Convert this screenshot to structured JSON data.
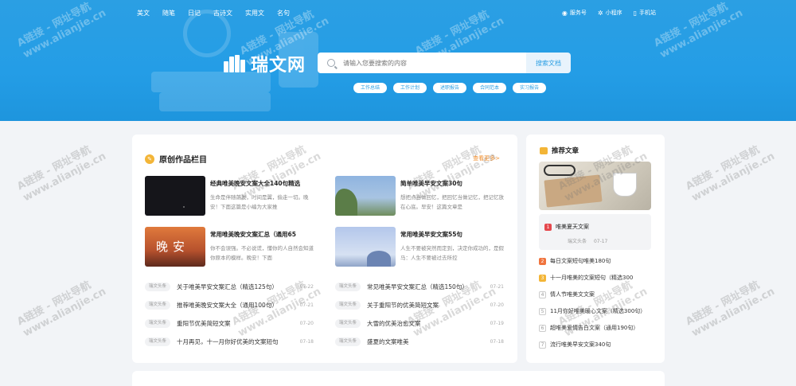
{
  "nav": {
    "items": [
      "美文",
      "随笔",
      "日记",
      "古诗文",
      "实用文",
      "名句"
    ],
    "right": [
      {
        "icon": "wechat-icon",
        "label": "服务号"
      },
      {
        "icon": "miniprogram-icon",
        "label": "小程序"
      },
      {
        "icon": "phone-icon",
        "label": "手机站"
      }
    ]
  },
  "logo": {
    "text": "瑞文网"
  },
  "search": {
    "placeholder": "请输入您要搜索的内容",
    "button": "搜索文档"
  },
  "tags": [
    "工作总结",
    "工作计划",
    "述职报告",
    "合同范本",
    "实习报告"
  ],
  "main": {
    "title": "原创作品栏目",
    "more": "查看更多>",
    "features": [
      {
        "title": "经典唯美晚安文案大全140句精选",
        "desc": "生命是伴随前发，时间是翼，偷走一切。晚安！下面这篇是小编为大家推"
      },
      {
        "title": "简单唯美早安文案30句",
        "desc": "想把点当做回忆，把回忆当做记忆，把记忆放在心底。早安！这篇文章是"
      },
      {
        "title": "常用唯美晚安文案汇总（通用65",
        "desc": "你不会误强。不必说谎，懂你的人自然会知道你原本的模样。晚安！下面",
        "image_text": "晚安"
      },
      {
        "title": "常用唯美早安文案55句",
        "desc": "人生不要被突然而定到，决定你成功的，是假马：人生不要被过去所控"
      }
    ],
    "list_left": [
      {
        "tag": "瑞文头条",
        "title": "关于唯美早安文案汇总（精选125句）",
        "date": "07-22"
      },
      {
        "tag": "瑞文头条",
        "title": "推荐唯美晚安文案大全（通用100句）",
        "date": "07-21"
      },
      {
        "tag": "瑞文头条",
        "title": "重阳节优美简短文案",
        "date": "07-20"
      },
      {
        "tag": "瑞文头条",
        "title": "十月再见，十一月你好优美的文案短句",
        "date": "07-18"
      }
    ],
    "list_right": [
      {
        "tag": "瑞文头条",
        "title": "常见唯美早安文案汇总（精选150句）",
        "date": "07-21"
      },
      {
        "tag": "瑞文头条",
        "title": "关于重阳节的优美简短文案",
        "date": "07-20"
      },
      {
        "tag": "瑞文头条",
        "title": "大雪的优美治愈文案",
        "date": "07-19"
      },
      {
        "tag": "瑞文头条",
        "title": "盛夏的文案唯美",
        "date": "07-18"
      }
    ]
  },
  "side": {
    "title": "推荐文章",
    "top": {
      "rank": "1",
      "title": "唯美夏天文案",
      "source": "瑞文头条",
      "date": "07-17"
    },
    "ranks": [
      {
        "rank": "2",
        "title": "每日文案短句唯美180句"
      },
      {
        "rank": "3",
        "title": "十一月唯美的文案短句（精选300"
      },
      {
        "rank": "4",
        "title": "情人节唯美文文案"
      },
      {
        "rank": "5",
        "title": "11月你好唯美暖心文案（精选300句）"
      },
      {
        "rank": "6",
        "title": "超唯美爱情告白文案（通用190句）"
      },
      {
        "rank": "7",
        "title": "流行唯美早安文案340句"
      }
    ]
  },
  "watermark": {
    "line1": "A链接 - 网址导航",
    "line2": "www.alianjie.cn"
  },
  "colors": {
    "brand": "#2b9fe3",
    "accent": "#f08c2a",
    "rank1": "#e5484d",
    "rank2": "#f0743e",
    "rank3": "#f3b537"
  }
}
